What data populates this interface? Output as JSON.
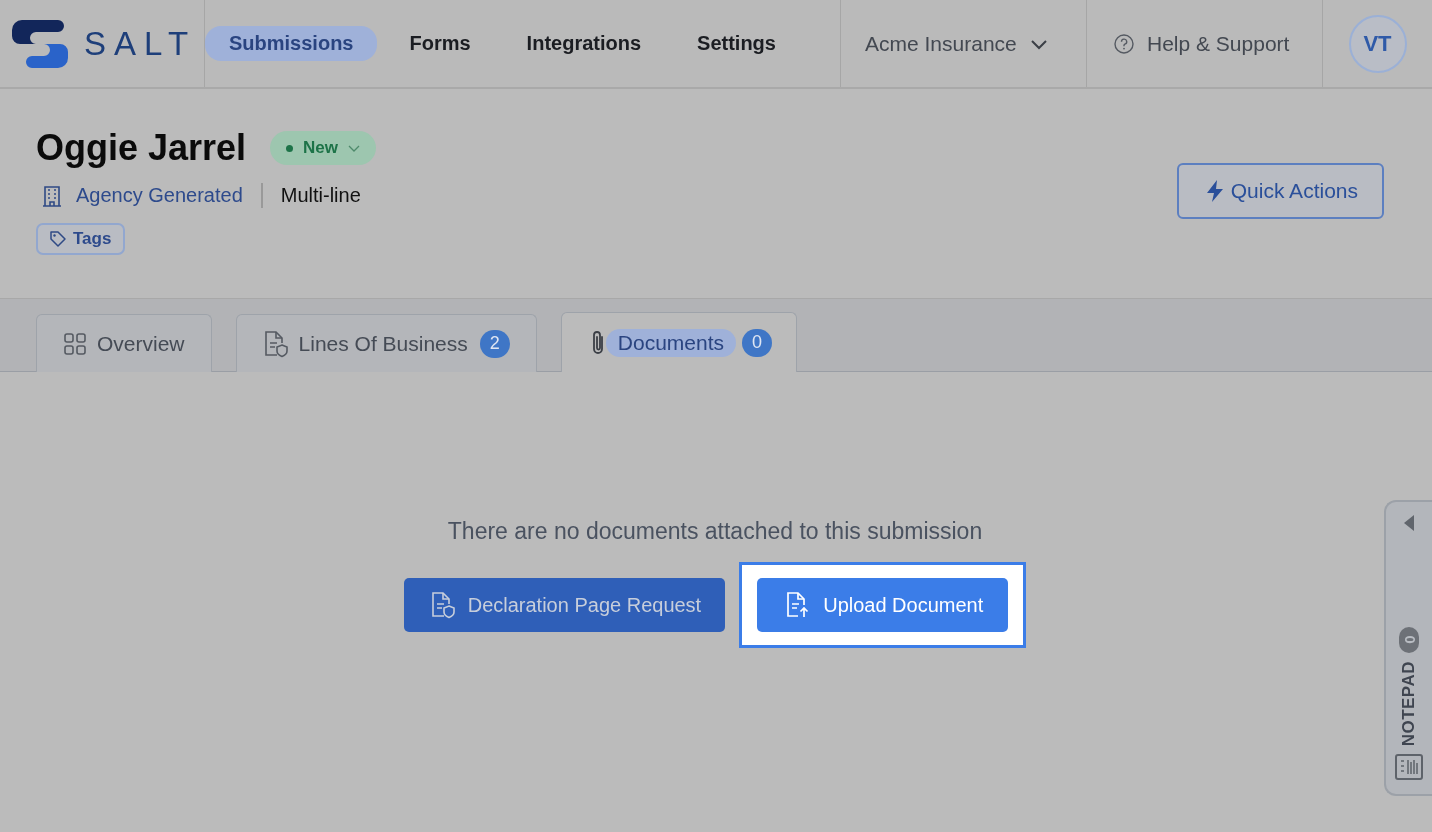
{
  "app": {
    "logo_text": "SALT"
  },
  "nav": [
    {
      "label": "Submissions",
      "selected": true
    },
    {
      "label": "Forms",
      "selected": false
    },
    {
      "label": "Integrations",
      "selected": false
    },
    {
      "label": "Settings",
      "selected": false
    }
  ],
  "account": {
    "label": "Acme Insurance"
  },
  "help": {
    "label": "Help & Support"
  },
  "avatar": {
    "initials": "VT"
  },
  "submission": {
    "name": "Oggie Jarrel",
    "status": "New",
    "source": "Agency Generated",
    "line_type": "Multi-line",
    "tags_label": "Tags"
  },
  "quick_actions": {
    "label": "Quick Actions"
  },
  "tabs": [
    {
      "label": "Overview",
      "selected": false
    },
    {
      "label": "Lines Of Business",
      "count": "2",
      "selected": false
    },
    {
      "label": "Documents",
      "count": "0",
      "selected": true
    }
  ],
  "empty_state": {
    "message": "There are no documents attached to this submission",
    "buttons": [
      {
        "label": "Declaration Page Request",
        "kind": "secondary",
        "highlighted": false
      },
      {
        "label": "Upload Document",
        "kind": "primary",
        "highlighted": true
      }
    ]
  },
  "notepad": {
    "label": "NOTEPAD",
    "count": "0"
  }
}
